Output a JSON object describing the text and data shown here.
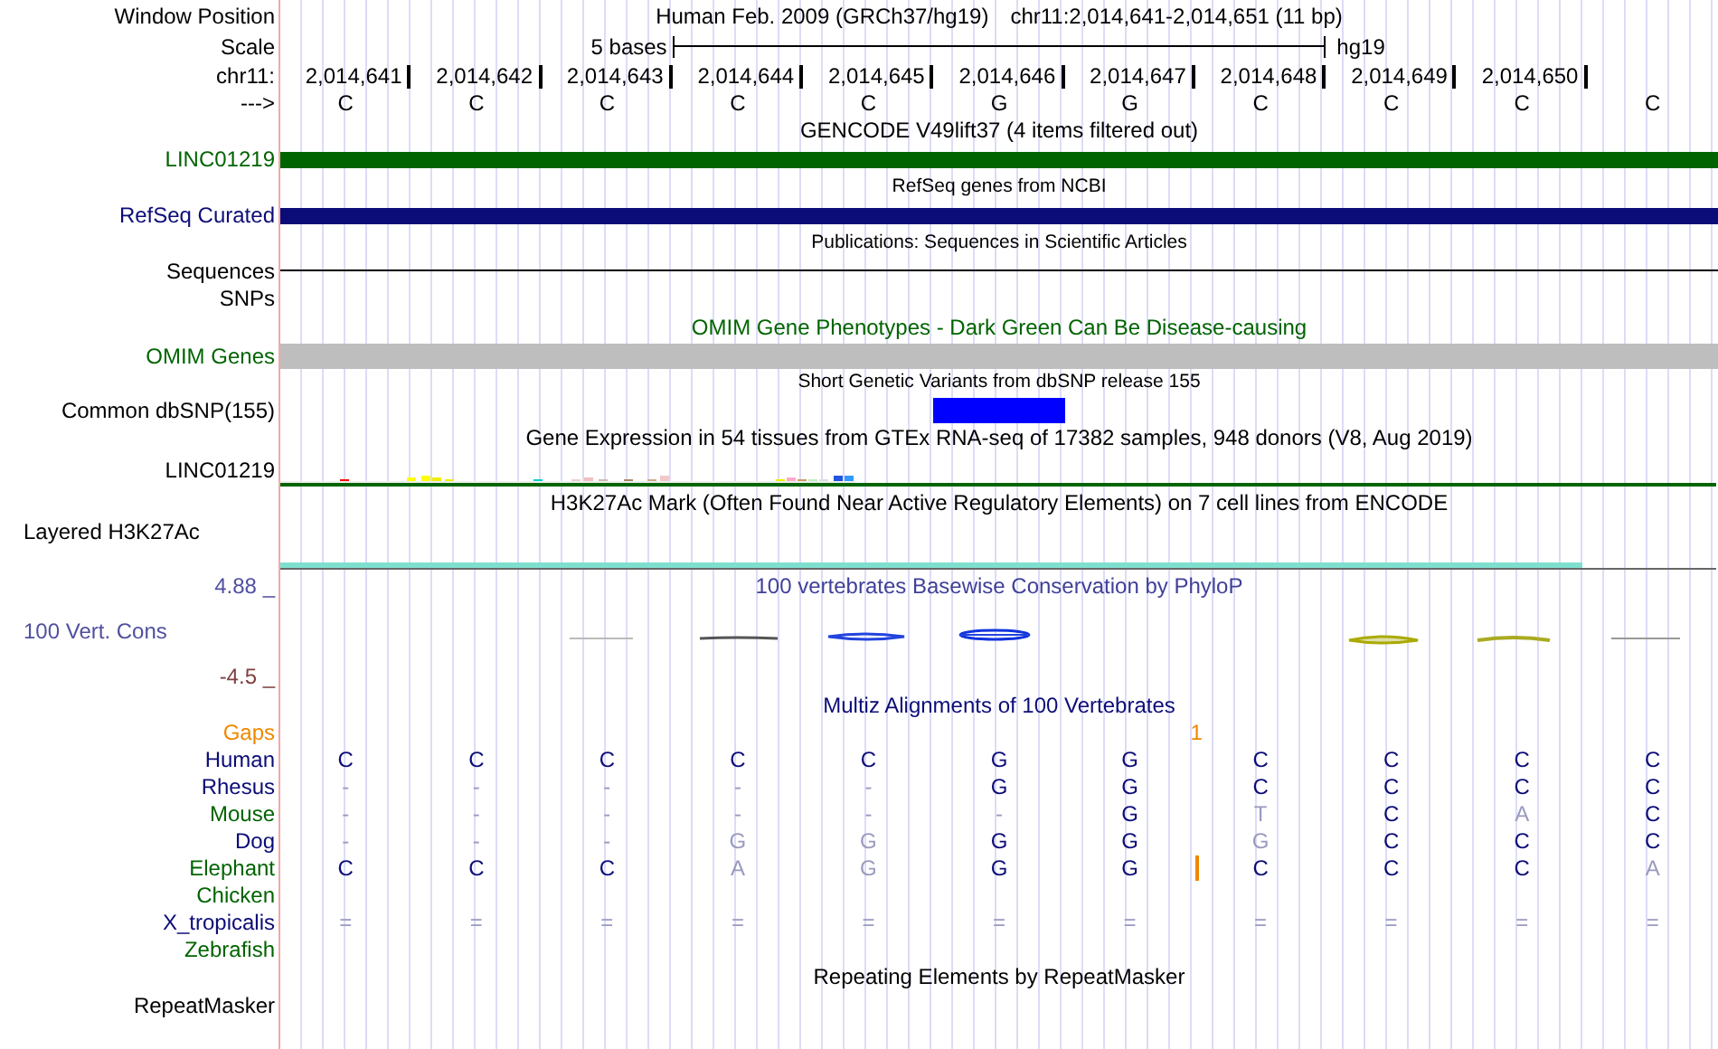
{
  "header": {
    "position_label": "Window Position",
    "assembly": "Human Feb. 2009 (GRCh37/hg19)",
    "range": "chr11:2,014,641-2,014,651 (11 bp)",
    "scale_label": "Scale",
    "scale_text": "5 bases",
    "scale_db": "hg19",
    "chrom_label": "chr11:",
    "positions": [
      "2,014,641",
      "2,014,642",
      "2,014,643",
      "2,014,644",
      "2,014,645",
      "2,014,646",
      "2,014,647",
      "2,014,648",
      "2,014,649",
      "2,014,650"
    ],
    "strand_label": "--->",
    "bases": [
      "C",
      "C",
      "C",
      "C",
      "C",
      "G",
      "G",
      "C",
      "C",
      "C",
      "C"
    ]
  },
  "tracks": [
    {
      "kind": "title",
      "title": {
        "text": "GENCODE V49lift37 (4 items filtered out)",
        "color": "#000000"
      }
    },
    {
      "kind": "gene_bar",
      "label": {
        "text": "LINC01219",
        "color": "#006400"
      },
      "bar": {
        "color": "#006400"
      }
    },
    {
      "kind": "caption",
      "title": {
        "text": "RefSeq genes from NCBI",
        "color": "#000000"
      }
    },
    {
      "kind": "gene_bar",
      "label": {
        "text": "RefSeq Curated",
        "color": "#0c0c78"
      },
      "bar": {
        "color": "#0c0c78"
      }
    },
    {
      "kind": "caption",
      "title": {
        "text": "Publications: Sequences in Scientific Articles",
        "color": "#000000"
      }
    },
    {
      "kind": "line",
      "label": {
        "text": "Sequences",
        "color": "#000000"
      }
    },
    {
      "kind": "empty",
      "label": {
        "text": "SNPs",
        "color": "#000000"
      }
    },
    {
      "kind": "title",
      "title": {
        "text": "OMIM Gene Phenotypes - Dark Green Can Be Disease-causing",
        "color": "#006400"
      }
    },
    {
      "kind": "block_bar",
      "label": {
        "text": "OMIM Genes",
        "color": "#006400"
      },
      "bar": {
        "color": "#bebebe"
      }
    },
    {
      "kind": "caption",
      "title": {
        "text": "Short Genetic Variants from dbSNP release 155",
        "color": "#000000"
      }
    },
    {
      "kind": "snp",
      "label": {
        "text": "Common dbSNP(155)",
        "color": "#000000"
      },
      "hits": [
        false,
        false,
        false,
        false,
        false,
        true,
        false,
        false,
        false,
        false,
        false
      ]
    },
    {
      "kind": "title",
      "title": {
        "text": "Gene Expression in 54 tissues from GTEx RNA-seq of 17382 samples, 948 donors (V8, Aug 2019)",
        "color": "#000000"
      }
    },
    {
      "kind": "expression",
      "label": {
        "text": "LINC01219",
        "color": "#000000"
      }
    },
    {
      "kind": "title",
      "title": {
        "text": "H3K27Ac Mark (Often Found Near Active Regulatory Elements) on 7 cell lines from ENCODE",
        "color": "#000000"
      }
    },
    {
      "kind": "signal",
      "label": {
        "text": "Layered H3K27Ac",
        "color": "#000000"
      }
    },
    {
      "kind": "title",
      "label": {
        "text": "4.88 _",
        "color": "#5050a0"
      },
      "title": {
        "text": "100 vertebrates Basewise Conservation by PhyloP",
        "color": "#40409a"
      }
    },
    {
      "kind": "conservation",
      "label": {
        "text": "100 Vert. Cons",
        "color": "#5050a0"
      }
    },
    {
      "kind": "empty",
      "label": {
        "text": "-4.5 _",
        "color": "#804040"
      }
    },
    {
      "kind": "title",
      "title": {
        "text": "Multiz Alignments of 100 Vertebrates",
        "color": "#0c0c78"
      }
    },
    {
      "kind": "gaps",
      "label": {
        "text": "Gaps",
        "color": "#ee8800"
      },
      "count": "1"
    },
    {
      "kind": "species",
      "label": {
        "text": "Human",
        "color": "#0c0c78"
      },
      "bases": [
        {
          "text": "C",
          "differs": false
        },
        {
          "text": "C",
          "differs": false
        },
        {
          "text": "C",
          "differs": false
        },
        {
          "text": "C",
          "differs": false
        },
        {
          "text": "C",
          "differs": false
        },
        {
          "text": "G",
          "differs": false
        },
        {
          "text": "G",
          "differs": false
        },
        {
          "text": "C",
          "differs": false
        },
        {
          "text": "C",
          "differs": false
        },
        {
          "text": "C",
          "differs": false
        },
        {
          "text": "C",
          "differs": false
        }
      ]
    },
    {
      "kind": "species",
      "label": {
        "text": "Rhesus",
        "color": "#0c0c78"
      },
      "bases": [
        {
          "text": "-",
          "differs": true
        },
        {
          "text": "-",
          "differs": true
        },
        {
          "text": "-",
          "differs": true
        },
        {
          "text": "-",
          "differs": true
        },
        {
          "text": "-",
          "differs": true
        },
        {
          "text": "G",
          "differs": false
        },
        {
          "text": "G",
          "differs": false
        },
        {
          "text": "C",
          "differs": false
        },
        {
          "text": "C",
          "differs": false
        },
        {
          "text": "C",
          "differs": false
        },
        {
          "text": "C",
          "differs": false
        }
      ]
    },
    {
      "kind": "species",
      "label": {
        "text": "Mouse",
        "color": "#006400"
      },
      "bases": [
        {
          "text": "-",
          "differs": true
        },
        {
          "text": "-",
          "differs": true
        },
        {
          "text": "-",
          "differs": true
        },
        {
          "text": "-",
          "differs": true
        },
        {
          "text": "-",
          "differs": true
        },
        {
          "text": "-",
          "differs": true
        },
        {
          "text": "G",
          "differs": false
        },
        {
          "text": "T",
          "differs": true
        },
        {
          "text": "C",
          "differs": false
        },
        {
          "text": "A",
          "differs": true
        },
        {
          "text": "C",
          "differs": false
        }
      ]
    },
    {
      "kind": "species",
      "label": {
        "text": "Dog",
        "color": "#0c0c78"
      },
      "bases": [
        {
          "text": "-",
          "differs": true
        },
        {
          "text": "-",
          "differs": true
        },
        {
          "text": "-",
          "differs": true
        },
        {
          "text": "G",
          "differs": true
        },
        {
          "text": "G",
          "differs": true
        },
        {
          "text": "G",
          "differs": false
        },
        {
          "text": "G",
          "differs": false
        },
        {
          "text": "G",
          "differs": true
        },
        {
          "text": "C",
          "differs": false
        },
        {
          "text": "C",
          "differs": false
        },
        {
          "text": "C",
          "differs": false
        }
      ]
    },
    {
      "kind": "species",
      "label": {
        "text": "Elephant",
        "color": "#006400"
      },
      "bases": [
        {
          "text": "C",
          "differs": false
        },
        {
          "text": "C",
          "differs": false
        },
        {
          "text": "C",
          "differs": false
        },
        {
          "text": "A",
          "differs": true
        },
        {
          "text": "G",
          "differs": true
        },
        {
          "text": "G",
          "differs": false
        },
        {
          "text": "G",
          "differs": false,
          "insert": true
        },
        {
          "text": "C",
          "differs": false
        },
        {
          "text": "C",
          "differs": false
        },
        {
          "text": "C",
          "differs": false
        },
        {
          "text": "A",
          "differs": true
        }
      ]
    },
    {
      "kind": "species",
      "label": {
        "text": "Chicken",
        "color": "#006400"
      }
    },
    {
      "kind": "species",
      "label": {
        "text": "X_tropicalis",
        "color": "#0c0c78"
      },
      "bases": [
        {
          "text": "=",
          "differs": true
        },
        {
          "text": "=",
          "differs": true
        },
        {
          "text": "=",
          "differs": true
        },
        {
          "text": "=",
          "differs": true
        },
        {
          "text": "=",
          "differs": true
        },
        {
          "text": "=",
          "differs": true
        },
        {
          "text": "=",
          "differs": true
        },
        {
          "text": "=",
          "differs": true
        },
        {
          "text": "=",
          "differs": true
        },
        {
          "text": "=",
          "differs": true
        },
        {
          "text": "=",
          "differs": true
        }
      ]
    },
    {
      "kind": "species",
      "label": {
        "text": "Zebrafish",
        "color": "#006400"
      }
    },
    {
      "kind": "title",
      "title": {
        "text": "Repeating Elements by RepeatMasker",
        "color": "#000000"
      }
    },
    {
      "kind": "empty",
      "label": {
        "text": "RepeatMasker",
        "color": "#000000"
      }
    }
  ]
}
